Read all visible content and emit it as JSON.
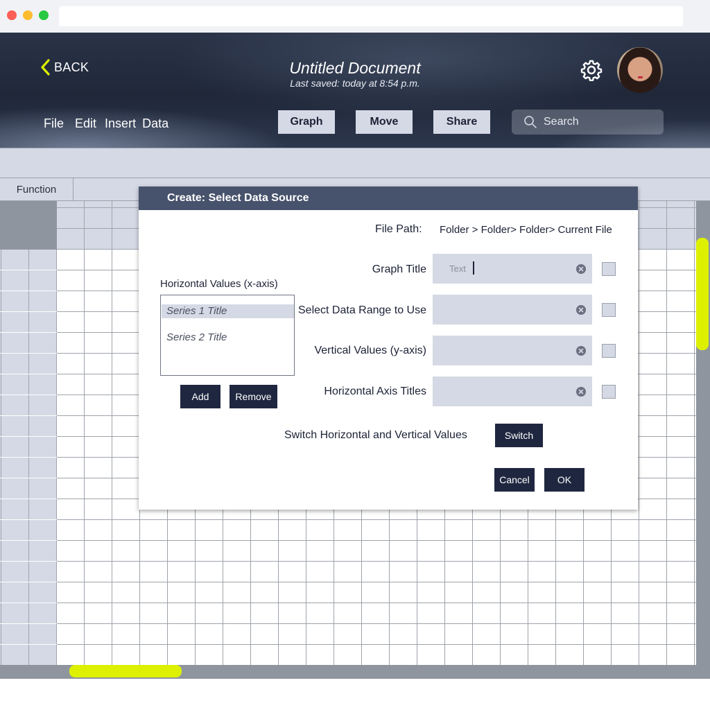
{
  "header": {
    "back_label": "BACK",
    "doc_title": "Untitled Document",
    "last_saved": "Last saved: today  at  8:54 p.m.",
    "menu": [
      "File",
      "Edit",
      "Insert",
      "Data"
    ],
    "buttons": [
      "Graph",
      "Move",
      "Share"
    ],
    "search_placeholder": "Search"
  },
  "sheet": {
    "function_label": "Function"
  },
  "dialog": {
    "title": "Create: Select Data Source",
    "file_path_label": "File  Path:",
    "file_path_value": "Folder > Folder> Folder> Current File",
    "horizontal_values_label": "Horizontal   Values   (x-axis)",
    "series": [
      "Series 1 Title",
      "Series 2 Title"
    ],
    "add_label": "Add",
    "remove_label": "Remove",
    "fields": [
      {
        "label": "Graph Title",
        "placeholder": "Text"
      },
      {
        "label": "Select Data Range to Use",
        "placeholder": ""
      },
      {
        "label": "Vertical Values (y-axis)",
        "placeholder": ""
      },
      {
        "label": "Horizontal Axis Titles",
        "placeholder": ""
      }
    ],
    "switch_prompt": "Switch Horizontal and Vertical   Values",
    "switch_label": "Switch",
    "cancel_label": "Cancel",
    "ok_label": "OK"
  },
  "colors": {
    "accent": "#ddf000",
    "header_dark": "#1f2739",
    "panel": "#d5d9e5",
    "button_dark": "#1f2740",
    "dialog_head": "#47526c"
  }
}
